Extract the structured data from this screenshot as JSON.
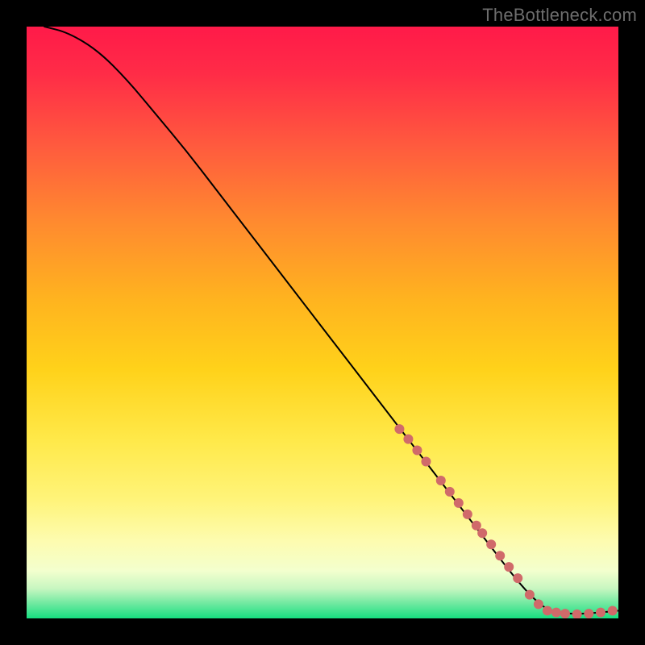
{
  "watermark": "TheBottleneck.com",
  "chart_data": {
    "type": "line",
    "title": "",
    "xlabel": "",
    "ylabel": "",
    "xlim": [
      0,
      100
    ],
    "ylim": [
      0,
      100
    ],
    "grid": false,
    "legend": false,
    "axes_visible": false,
    "gradient_background": {
      "top_to_bottom": [
        "#ff1744",
        "#ff3546",
        "#ff6d3a",
        "#ffa726",
        "#ffd21f",
        "#ffee58",
        "#fff6a0",
        "#fdffce",
        "#a7f0b2",
        "#18e07f"
      ]
    },
    "series": [
      {
        "name": "main-curve",
        "color": "#000000",
        "stroke_width": 2,
        "x": [
          3,
          7,
          12,
          17,
          22,
          27,
          32,
          37,
          42,
          47,
          52,
          57,
          62,
          67,
          72,
          77,
          82,
          85,
          88,
          92,
          96,
          100
        ],
        "y": [
          100,
          99,
          96,
          91,
          85,
          79,
          72.5,
          66,
          59.5,
          53,
          46.5,
          40,
          33.5,
          27,
          20.5,
          14,
          7.5,
          4,
          1.3,
          0.7,
          0.9,
          1.3
        ]
      }
    ],
    "scatter": {
      "name": "highlight-points",
      "color": "#d06a6a",
      "radius": 6,
      "x": [
        63,
        64.5,
        66,
        67.5,
        70,
        71.5,
        73,
        74.5,
        76,
        77,
        78.5,
        80,
        81.5,
        83,
        85,
        86.5,
        88,
        89.5,
        91,
        93,
        95,
        97,
        99
      ],
      "y": [
        32,
        30.3,
        28.4,
        26.5,
        23.3,
        21.4,
        19.5,
        17.6,
        15.7,
        14.4,
        12.5,
        10.6,
        8.7,
        6.8,
        4,
        2.4,
        1.3,
        1.0,
        0.8,
        0.7,
        0.8,
        1.0,
        1.3
      ]
    }
  }
}
